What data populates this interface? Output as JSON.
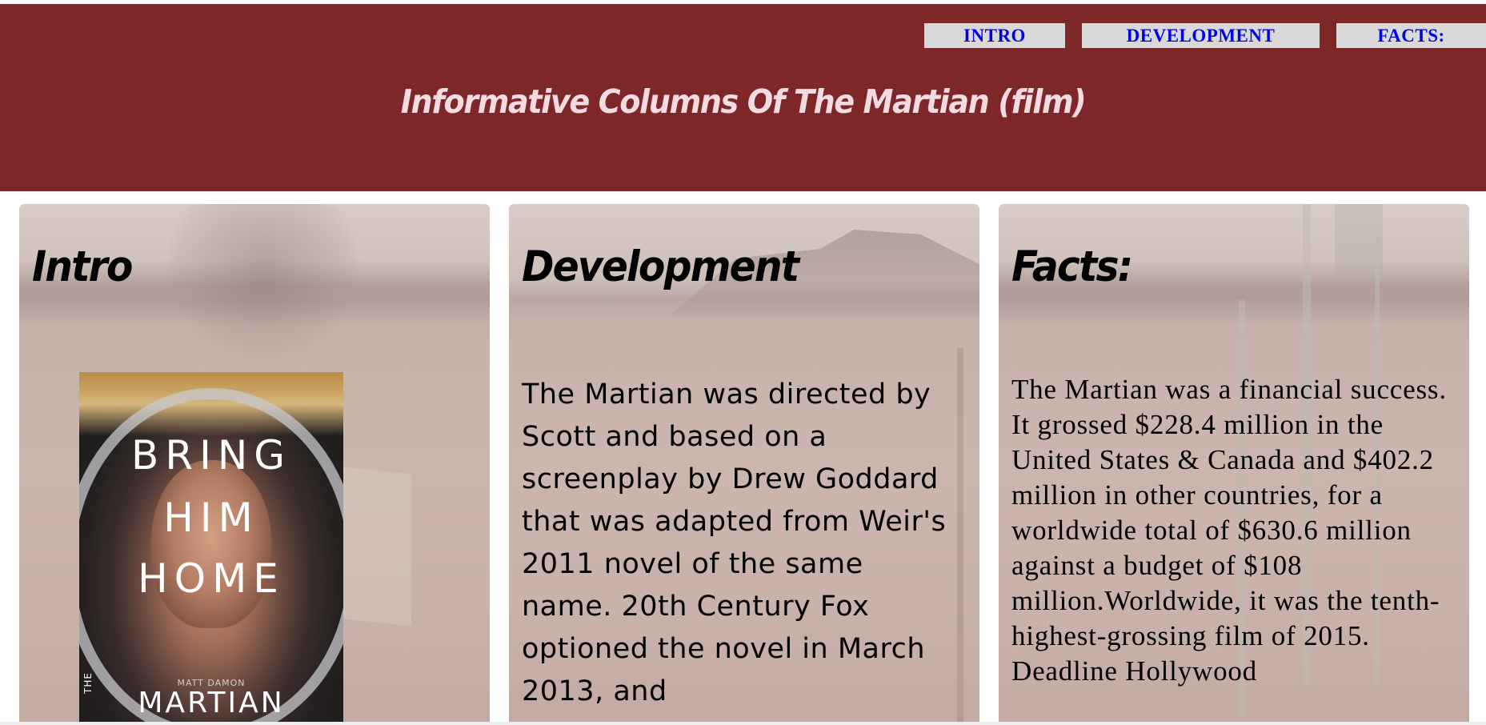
{
  "nav": {
    "intro": "INTRO",
    "development": "DEVELOPMENT",
    "facts": "FACTS:"
  },
  "header": {
    "title": "Informative Columns Of The Martian (film)"
  },
  "columns": [
    {
      "heading": "Intro",
      "poster": {
        "line1": "BRING",
        "line2": "HIM",
        "line3": "HOME",
        "credit": "MATT DAMON",
        "the": "THE",
        "title": "MARTIAN"
      }
    },
    {
      "heading": "Development",
      "text": "The Martian was directed by Scott and based on a screenplay by Drew Goddard that was adapted from Weir's 2011 novel of the same name. 20th Century Fox optioned the novel in March 2013, and"
    },
    {
      "heading": "Facts:",
      "text": "The Martian was a financial success. It grossed $228.4 million in the United States & Canada and $402.2 million in other countries, for a worldwide total of $630.6 million against a budget of $108 million.Worldwide, it was the tenth-highest-grossing film of 2015. Deadline Hollywood"
    }
  ],
  "colors": {
    "header_bg": "#7d2729",
    "title_text": "#f3dbe1",
    "nav_bg": "#d9d9d9",
    "nav_link": "#0000ee"
  }
}
